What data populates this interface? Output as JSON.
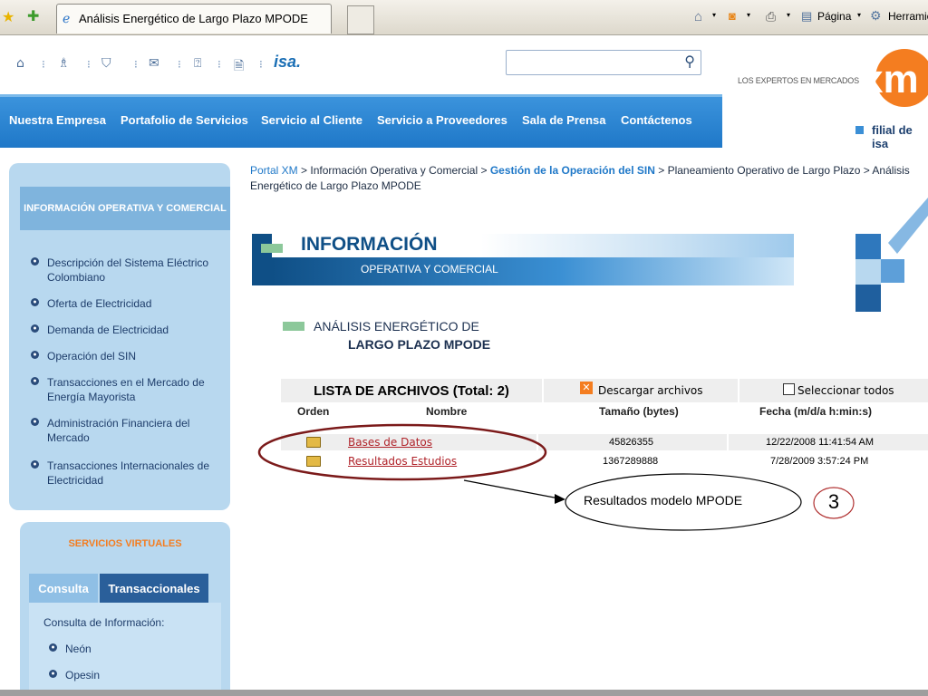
{
  "browser": {
    "tab_title": "Análisis Energético de Largo Plazo MPODE",
    "tools": [
      "Página",
      "Herramie"
    ]
  },
  "util_icons": [
    "home-icon",
    "sitemap-icon",
    "users-icon",
    "mail-icon",
    "help-icon",
    "document-icon"
  ],
  "isa_logo": "isa.",
  "search": {
    "placeholder": ""
  },
  "nav": [
    "Nuestra Empresa",
    "Portafolio de Servicios",
    "Servicio al Cliente",
    "Servicio a Proveedores",
    "Sala de Prensa",
    "Contáctenos"
  ],
  "brand": {
    "slogan": "LOS EXPERTOS EN MERCADOS",
    "logo": "xm",
    "filial": "filial de isa",
    "accent": "#f47d20",
    "blue": "#1f78c8"
  },
  "sidebar": {
    "header": "INFORMACIÓN OPERATIVA Y COMERCIAL",
    "items": [
      "Descripción del Sistema Eléctrico Colombiano",
      "Oferta de Electricidad",
      "Demanda de Electricidad",
      "Operación del SIN",
      "Transacciones en el Mercado de Energía Mayorista",
      "Administración Financiera del Mercado",
      "Transacciones Internacionales de Electricidad"
    ],
    "services_title": "SERVICIOS VIRTUALES",
    "tabs": [
      "Consulta",
      "Transaccionales"
    ],
    "consulta_heading": "Consulta de Información:",
    "consulta_items": [
      "Neón",
      "Opesin"
    ]
  },
  "breadcrumb": {
    "portal": "Portal XM",
    "sep": ">",
    "info": "Información Operativa y Comercial",
    "gestion": "Gestión de la Operación del SIN",
    "plan": "Planeamiento Operativo de Largo Plazo",
    "current": "Análisis Energético de Largo Plazo MPODE"
  },
  "banner": {
    "title": "INFORMACIÓN",
    "subtitle": "OPERATIVA Y COMERCIAL"
  },
  "section": {
    "line1": "ANÁLISIS ENERGÉTICO DE",
    "line2": "LARGO PLAZO MPODE"
  },
  "file_list": {
    "title": "LISTA DE ARCHIVOS (Total: 2)",
    "download_label": "Descargar archivos",
    "select_all_label": "Seleccionar todos",
    "columns": [
      "Orden",
      "Nombre",
      "Tamaño (bytes)",
      "Fecha  (m/d/a h:min:s)"
    ],
    "rows": [
      {
        "name": "Bases de Datos",
        "size": "45826355",
        "date": "12/22/2008 11:41:54 AM"
      },
      {
        "name": "Resultados Estudios",
        "size": "1367289888",
        "date": "7/28/2009 3:57:24 PM"
      }
    ]
  },
  "annotation": {
    "callout": "Resultados modelo MPODE",
    "number": "3"
  }
}
